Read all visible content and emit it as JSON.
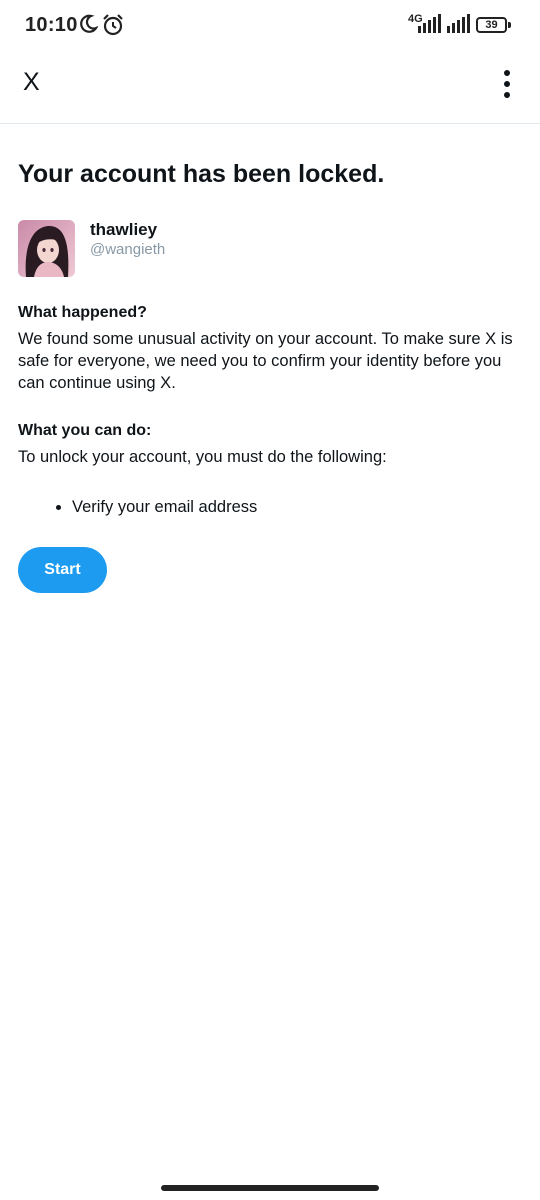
{
  "status_bar": {
    "time": "10:10",
    "network": "4G",
    "battery": "39",
    "icons": [
      "moon-icon",
      "alarm-icon",
      "signal-icon",
      "signal-icon",
      "battery-icon"
    ]
  },
  "header": {
    "logo": "X",
    "menu_icon": "more-vertical-icon"
  },
  "page": {
    "title": "Your account has been locked.",
    "user": {
      "display_name": "thawliey",
      "handle": "@wangieth"
    },
    "what_happened": {
      "heading": "What happened?",
      "text": "We found some unusual activity on your account. To make sure X is safe for everyone, we need you to confirm your identity before you can continue using X."
    },
    "what_you_can_do": {
      "heading": "What you can do:",
      "text": "To unlock your account, you must do the following:",
      "steps": [
        "Verify your email address"
      ]
    },
    "start_label": "Start"
  },
  "colors": {
    "accent": "#1d9bf0",
    "text": "#0f1419",
    "muted": "#8899a6"
  }
}
